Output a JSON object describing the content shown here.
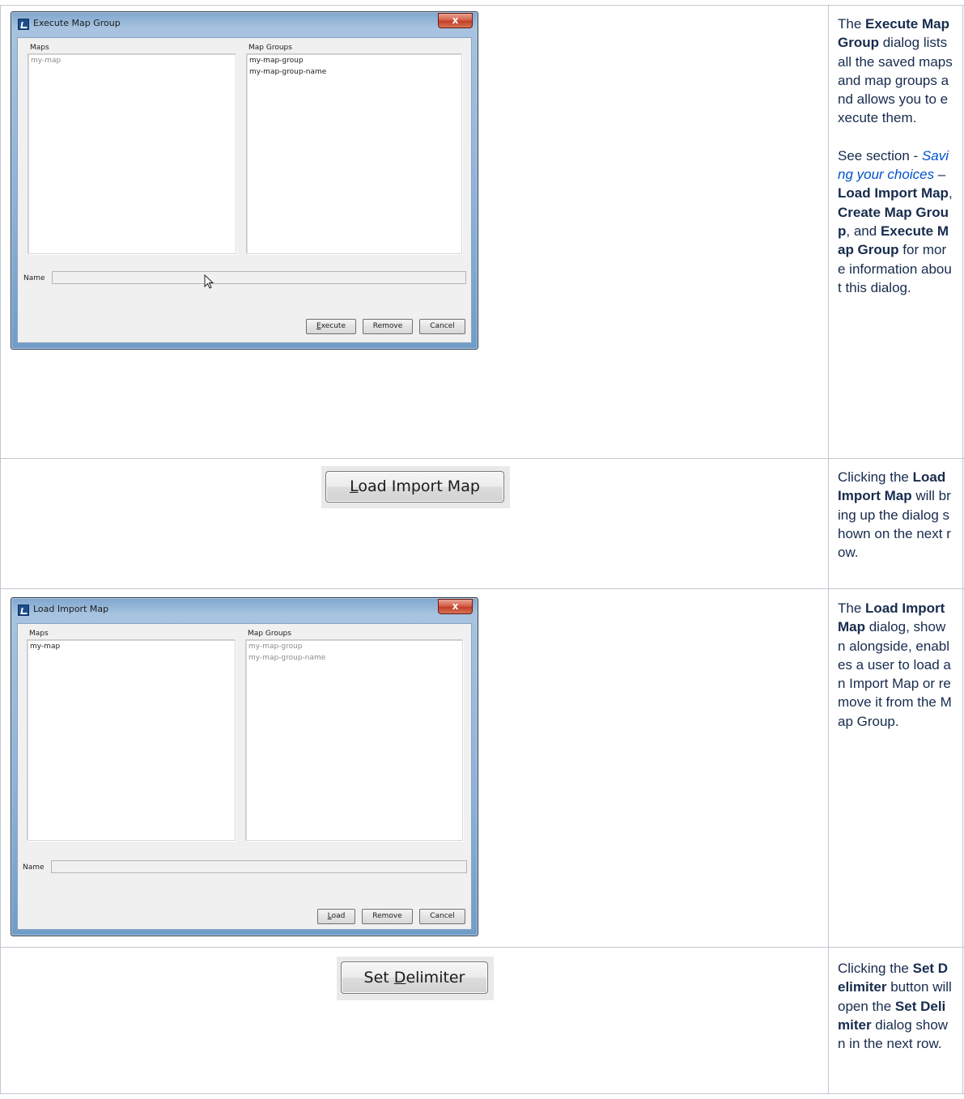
{
  "rows": [
    {
      "dialog": {
        "title": "Execute Map Group",
        "close_glyph": "x",
        "maps_label": "Maps",
        "maps_items": [
          {
            "text": "my-map",
            "dim": true
          }
        ],
        "groups_label": "Map Groups",
        "groups_items": [
          {
            "text": "my-map-group",
            "dim": false
          },
          {
            "text": "my-map-group-name",
            "dim": false
          }
        ],
        "name_label": "Name",
        "buttons": [
          {
            "pre": "",
            "u": "E",
            "post": "xecute"
          },
          {
            "pre": "Remove",
            "u": "",
            "post": ""
          },
          {
            "pre": "Cancel",
            "u": "",
            "post": ""
          }
        ]
      },
      "description": {
        "p1_a": "The ",
        "p1_b1": "Execute Map Group",
        "p1_c": " dialog lists all the saved maps and map groups and allows you to execute them.",
        "p2_a": "See section - ",
        "p2_link": "Saving your choices",
        "p2_b": " – ",
        "p2_b1": "Load Import Map",
        "p2_c": ", ",
        "p2_b2": "Create Map Group",
        "p2_d": ", and ",
        "p2_b3": "Execute Map Group",
        "p2_e": " for more information about this dialog."
      }
    },
    {
      "button": {
        "pre": "",
        "u": "L",
        "post": "oad Import Map"
      },
      "description": {
        "a": "Clicking the ",
        "b1": "Load Import Map",
        "c": " will bring up the dialog shown on the next row."
      }
    },
    {
      "dialog": {
        "title": "Load Import Map",
        "close_glyph": "x",
        "maps_label": "Maps",
        "maps_items": [
          {
            "text": "my-map",
            "dim": false
          }
        ],
        "groups_label": "Map Groups",
        "groups_items": [
          {
            "text": "my-map-group",
            "dim": true
          },
          {
            "text": "my-map-group-name",
            "dim": true
          }
        ],
        "name_label": "Name",
        "buttons": [
          {
            "pre": "",
            "u": "L",
            "post": "oad"
          },
          {
            "pre": "Remove",
            "u": "",
            "post": ""
          },
          {
            "pre": "Cancel",
            "u": "",
            "post": ""
          }
        ]
      },
      "description": {
        "a": "The ",
        "b1": "Load Import Map",
        "c": " dialog, shown alongside, enables a user to load an Import Map or remove it from the Map Group."
      }
    },
    {
      "button": {
        "pre": "Set ",
        "u": "D",
        "post": "elimiter"
      },
      "description": {
        "a": "Clicking the ",
        "b1": "Set Delimiter",
        "c": " button will open the ",
        "b2": "Set Delimiter",
        "d": " dialog shown in the next row."
      }
    }
  ]
}
